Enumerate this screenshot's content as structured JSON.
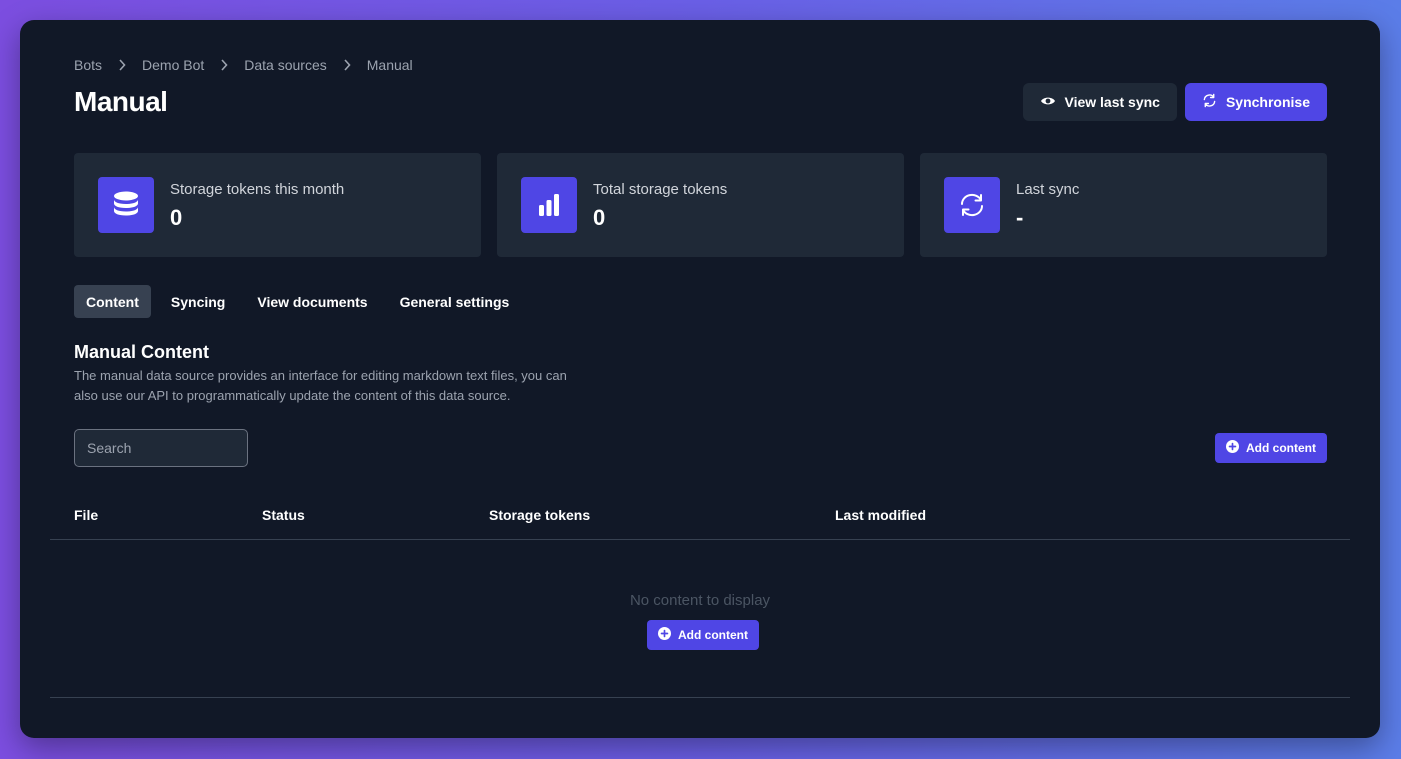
{
  "breadcrumb": [
    "Bots",
    "Demo Bot",
    "Data sources",
    "Manual"
  ],
  "page": {
    "title": "Manual"
  },
  "header": {
    "view_last_sync_label": "View last sync",
    "synchronise_label": "Synchronise"
  },
  "stats": [
    {
      "label": "Storage tokens this month",
      "value": "0",
      "icon": "database-icon"
    },
    {
      "label": "Total storage tokens",
      "value": "0",
      "icon": "bar-chart-icon"
    },
    {
      "label": "Last sync",
      "value": "-",
      "icon": "sync-icon"
    }
  ],
  "tabs": [
    {
      "label": "Content",
      "active": true
    },
    {
      "label": "Syncing",
      "active": false
    },
    {
      "label": "View documents",
      "active": false
    },
    {
      "label": "General settings",
      "active": false
    }
  ],
  "section": {
    "title": "Manual Content",
    "description": "The manual data source provides an interface for editing markdown text files, you can also use our API to programmatically update the content of this data source."
  },
  "search": {
    "placeholder": "Search",
    "value": ""
  },
  "add_content_label": "Add content",
  "table": {
    "columns": [
      "File",
      "Status",
      "Storage tokens",
      "Last modified"
    ],
    "rows": [],
    "empty_text": "No content to display"
  },
  "colors": {
    "background": "#111827",
    "card": "#1f2937",
    "accent": "#4f46e5",
    "muted_text": "#9ca3af"
  }
}
